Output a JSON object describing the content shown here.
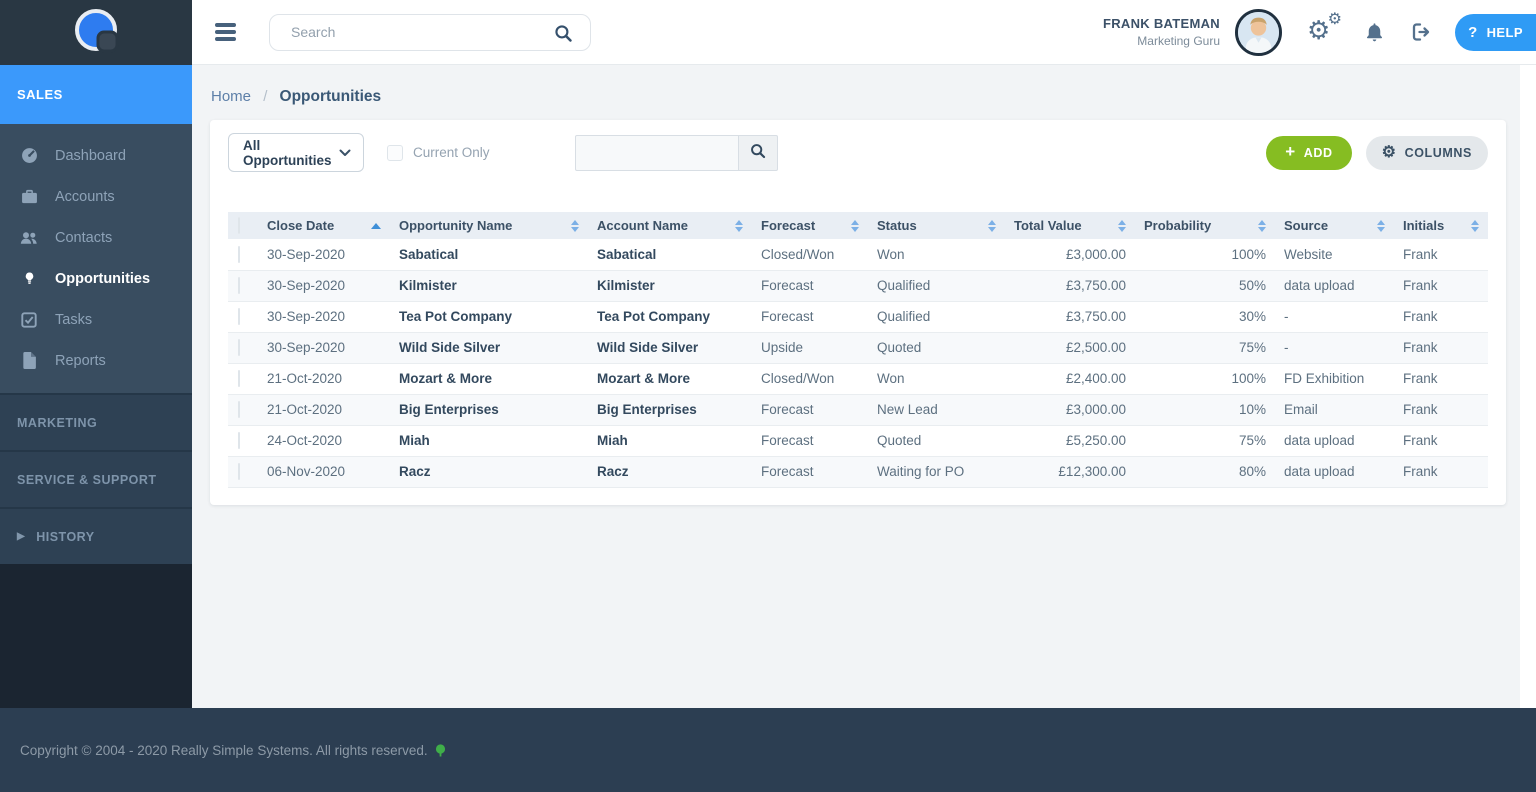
{
  "topbar": {
    "search_placeholder": "Search",
    "user_name": "FRANK BATEMAN",
    "user_role": "Marketing Guru",
    "help_icon": "?",
    "help_label": "HELP"
  },
  "sidebar": {
    "active_module": "SALES",
    "nav_items": [
      {
        "label": "Dashboard",
        "icon": "dashboard-icon",
        "active": false
      },
      {
        "label": "Accounts",
        "icon": "accounts-icon",
        "active": false
      },
      {
        "label": "Contacts",
        "icon": "contacts-icon",
        "active": false
      },
      {
        "label": "Opportunities",
        "icon": "opportunities-icon",
        "active": true
      },
      {
        "label": "Tasks",
        "icon": "tasks-icon",
        "active": false
      },
      {
        "label": "Reports",
        "icon": "reports-icon",
        "active": false
      }
    ],
    "sections": [
      {
        "label": "MARKETING",
        "expandable": false
      },
      {
        "label": "SERVICE & SUPPORT",
        "expandable": false
      },
      {
        "label": "HISTORY",
        "expandable": true
      }
    ]
  },
  "breadcrumb": {
    "home": "Home",
    "separator": "/",
    "current": "Opportunities"
  },
  "toolbar": {
    "view_filter": "All Opportunities",
    "current_only_label": "Current Only",
    "search_value": "",
    "add_label": "ADD",
    "columns_label": "COLUMNS"
  },
  "table": {
    "columns": [
      {
        "key": "close_date",
        "label": "Close Date",
        "sort": "asc"
      },
      {
        "key": "opportunity_name",
        "label": "Opportunity Name",
        "sort": "both"
      },
      {
        "key": "account_name",
        "label": "Account Name",
        "sort": "both"
      },
      {
        "key": "forecast",
        "label": "Forecast",
        "sort": "both"
      },
      {
        "key": "status",
        "label": "Status",
        "sort": "both"
      },
      {
        "key": "total_value",
        "label": "Total Value",
        "sort": "both"
      },
      {
        "key": "probability",
        "label": "Probability",
        "sort": "both"
      },
      {
        "key": "source",
        "label": "Source",
        "sort": "both"
      },
      {
        "key": "initials",
        "label": "Initials",
        "sort": "both"
      }
    ],
    "rows": [
      {
        "close_date": "30-Sep-2020",
        "opportunity_name": "Sabatical",
        "account_name": "Sabatical",
        "forecast": "Closed/Won",
        "status": "Won",
        "total_value": "£3,000.00",
        "probability": "100%",
        "source": "Website",
        "initials": "Frank"
      },
      {
        "close_date": "30-Sep-2020",
        "opportunity_name": "Kilmister",
        "account_name": "Kilmister",
        "forecast": "Forecast",
        "status": "Qualified",
        "total_value": "£3,750.00",
        "probability": "50%",
        "source": "data upload",
        "initials": "Frank"
      },
      {
        "close_date": "30-Sep-2020",
        "opportunity_name": "Tea Pot Company",
        "account_name": "Tea Pot Company",
        "forecast": "Forecast",
        "status": "Qualified",
        "total_value": "£3,750.00",
        "probability": "30%",
        "source": "-",
        "initials": "Frank"
      },
      {
        "close_date": "30-Sep-2020",
        "opportunity_name": "Wild Side Silver",
        "account_name": "Wild Side Silver",
        "forecast": "Upside",
        "status": "Quoted",
        "total_value": "£2,500.00",
        "probability": "75%",
        "source": "-",
        "initials": "Frank"
      },
      {
        "close_date": "21-Oct-2020",
        "opportunity_name": "Mozart & More",
        "account_name": "Mozart & More",
        "forecast": "Closed/Won",
        "status": "Won",
        "total_value": "£2,400.00",
        "probability": "100%",
        "source": "FD Exhibition",
        "initials": "Frank"
      },
      {
        "close_date": "21-Oct-2020",
        "opportunity_name": "Big Enterprises",
        "account_name": "Big Enterprises",
        "forecast": "Forecast",
        "status": "New Lead",
        "total_value": "£3,000.00",
        "probability": "10%",
        "source": "Email",
        "initials": "Frank"
      },
      {
        "close_date": "24-Oct-2020",
        "opportunity_name": "Miah",
        "account_name": "Miah",
        "forecast": "Forecast",
        "status": "Quoted",
        "total_value": "£5,250.00",
        "probability": "75%",
        "source": "data upload",
        "initials": "Frank"
      },
      {
        "close_date": "06-Nov-2020",
        "opportunity_name": "Racz",
        "account_name": "Racz",
        "forecast": "Forecast",
        "status": "Waiting for PO",
        "total_value": "£12,300.00",
        "probability": "80%",
        "source": "data upload",
        "initials": "Frank"
      }
    ]
  },
  "footer": {
    "copyright": "Copyright © 2004 - 2020 Really Simple Systems. All rights reserved."
  },
  "colors": {
    "accent_blue": "#3b99fb",
    "help_blue": "#2f9bf5",
    "add_green": "#86bd22",
    "footer_green": "#3fae49",
    "sidebar_dark": "#293743",
    "sidebar_mid": "#394d60",
    "footer_bg": "#2c3e52"
  }
}
